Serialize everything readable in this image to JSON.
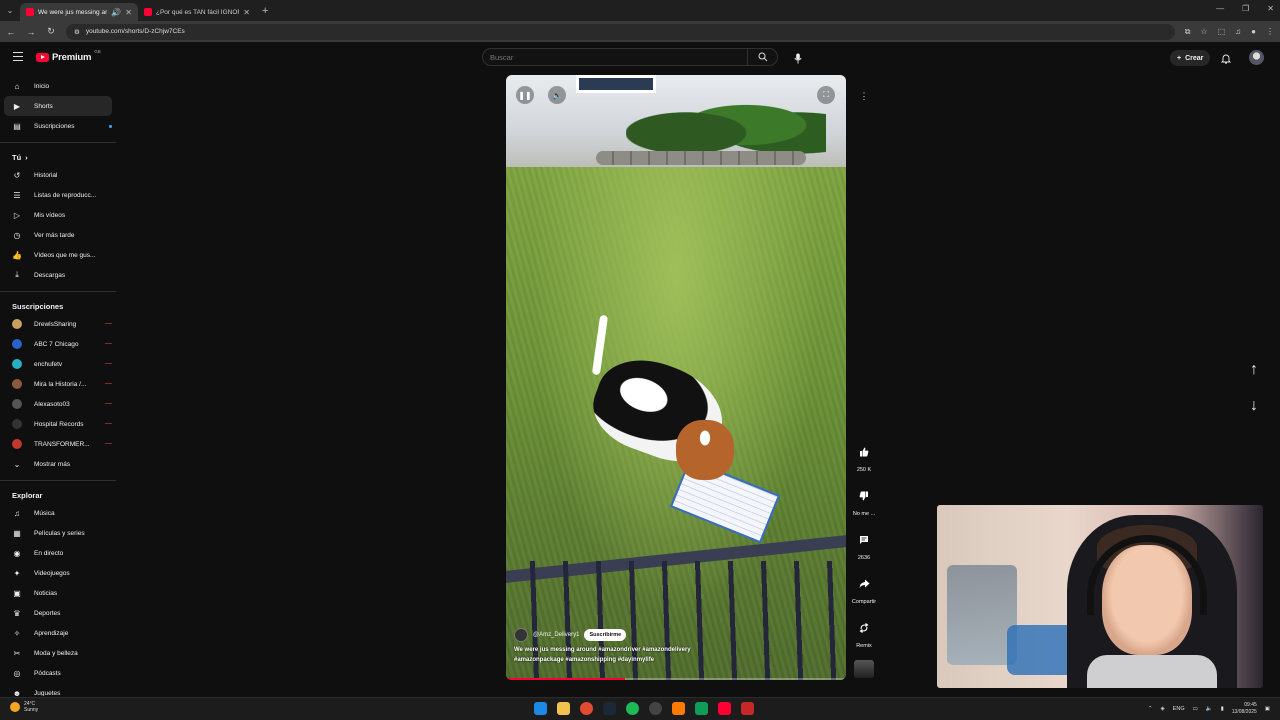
{
  "browser": {
    "tabs": [
      {
        "title": "We were jus messing aroun",
        "active": true
      },
      {
        "title": "¿Por qué es TAN fácil IGNORAR",
        "active": false
      }
    ],
    "url": "youtube.com/shorts/D-zChjw7CEs"
  },
  "header": {
    "brand": "Premium",
    "country": "GB",
    "search_placeholder": "Buscar",
    "create_label": "Crear"
  },
  "sidebar": {
    "main": [
      {
        "label": "Inicio",
        "icon": "home-icon"
      },
      {
        "label": "Shorts",
        "icon": "shorts-icon",
        "active": true
      },
      {
        "label": "Suscripciones",
        "icon": "subscriptions-icon"
      }
    ],
    "you_title": "Tú",
    "you": [
      {
        "label": "Historial",
        "icon": "history-icon"
      },
      {
        "label": "Listas de reproducc...",
        "icon": "playlists-icon"
      },
      {
        "label": "Mis vídeos",
        "icon": "my-videos-icon"
      },
      {
        "label": "Ver más tarde",
        "icon": "watch-later-icon"
      },
      {
        "label": "Vídeos que me gus...",
        "icon": "liked-icon"
      },
      {
        "label": "Descargas",
        "icon": "downloads-icon"
      }
    ],
    "subs_title": "Suscripciones",
    "subs": [
      {
        "label": "DrewlsSharing",
        "color": "#c8a060"
      },
      {
        "label": "ABC 7 Chicago",
        "color": "#2a62c9"
      },
      {
        "label": "enchufetv",
        "color": "#27b0c4"
      },
      {
        "label": "Mira la Historia /...",
        "color": "#8a5a40"
      },
      {
        "label": "Alexasoto03",
        "color": "#555555"
      },
      {
        "label": "Hospital Records",
        "color": "#333333"
      },
      {
        "label": "TRANSFORMER...",
        "color": "#c0392b"
      }
    ],
    "show_more": "Mostrar más",
    "explore_title": "Explorar",
    "explore": [
      {
        "label": "Música",
        "icon": "music-icon"
      },
      {
        "label": "Películas y series",
        "icon": "movies-icon"
      },
      {
        "label": "En directo",
        "icon": "live-icon"
      },
      {
        "label": "Videojuegos",
        "icon": "gaming-icon"
      },
      {
        "label": "Noticias",
        "icon": "news-icon"
      },
      {
        "label": "Deportes",
        "icon": "sports-icon"
      },
      {
        "label": "Aprendizaje",
        "icon": "learning-icon"
      },
      {
        "label": "Moda y belleza",
        "icon": "fashion-icon"
      },
      {
        "label": "Pódcasts",
        "icon": "podcasts-icon"
      },
      {
        "label": "Juguetes",
        "icon": "toys-icon"
      }
    ]
  },
  "short": {
    "channel": "@Amz_Delivery1",
    "subscribe": "Suscribirme",
    "description_line1": "We were jus messing around #amazondriver #amazondelivery",
    "description_line2": "#amazonpackage #amazonshipping #dayinmylife",
    "progress_fraction": 0.35
  },
  "actions": {
    "likes": "250 K",
    "dislike": "No me ...",
    "comments": "2636",
    "share": "Compartir",
    "remix": "Remix"
  },
  "taskbar": {
    "temp": "24°C",
    "weather": "Sunny",
    "lang": "ENG",
    "time": "09:45",
    "date": "13/08/2025"
  }
}
